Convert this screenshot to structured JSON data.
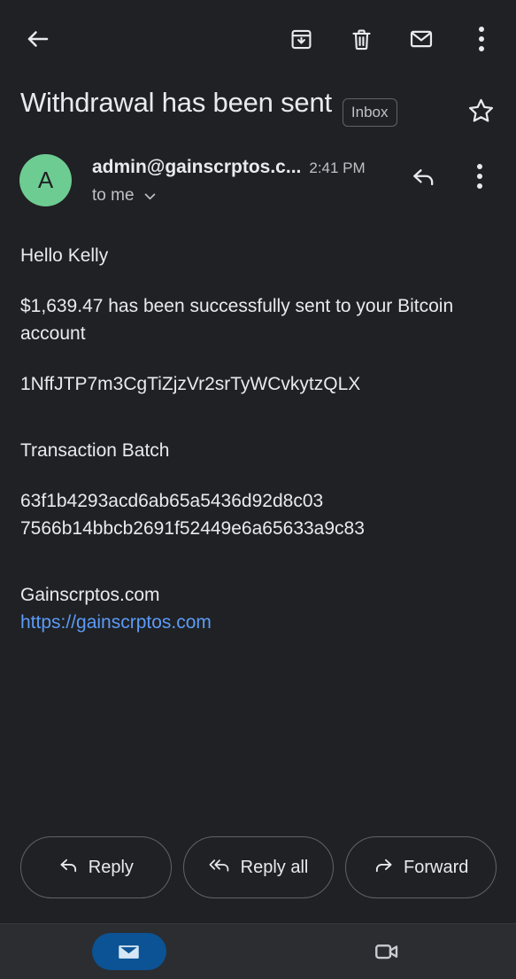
{
  "appbar": {
    "back_label": "Back",
    "actions": [
      {
        "name": "archive-icon",
        "label": "Archive"
      },
      {
        "name": "delete-icon",
        "label": "Delete"
      },
      {
        "name": "mark-unread-icon",
        "label": "Mark as unread"
      },
      {
        "name": "more-options-icon",
        "label": "More options"
      }
    ]
  },
  "email": {
    "subject": "Withdrawal has been sent",
    "label_chip": "Inbox",
    "star_label": "Star",
    "sender_address": "admin@gainscrptos.c...",
    "time": "2:41 PM",
    "recipient": "to me",
    "avatar_letter": "A",
    "reply_icon_label": "Reply",
    "more_icon_label": "More",
    "body": {
      "greeting": "Hello Kelly",
      "amount_sentence": "$1,639.47 has been successfully sent to your Bitcoin account",
      "bitcoin_address": "1NffJTP7m3CgTiZjzVr2srTyWCvkytzQLX",
      "batch_heading": "Transaction Batch",
      "batch_hash_line1": "63f1b4293acd6ab65a5436d92d8c03",
      "batch_hash_line2": "7566b14bbcb2691f52449e6a65633a9c83",
      "site_name": "Gainscrptos.com",
      "site_url": "https://gainscrptos.com"
    }
  },
  "actions": {
    "reply": "Reply",
    "reply_all": "Reply all",
    "forward": "Forward"
  },
  "bottomnav": {
    "mail_label": "Mail",
    "meet_label": "Meet"
  },
  "colors": {
    "background": "#202124",
    "text_primary": "#e8eaed",
    "text_secondary": "#bdc1c6",
    "avatar_green": "#6dcc92",
    "link_blue": "#5b9bf8",
    "nav_active_blue": "#0b5394",
    "navbar_background": "#2b2d31",
    "outline": "#5f6368"
  }
}
